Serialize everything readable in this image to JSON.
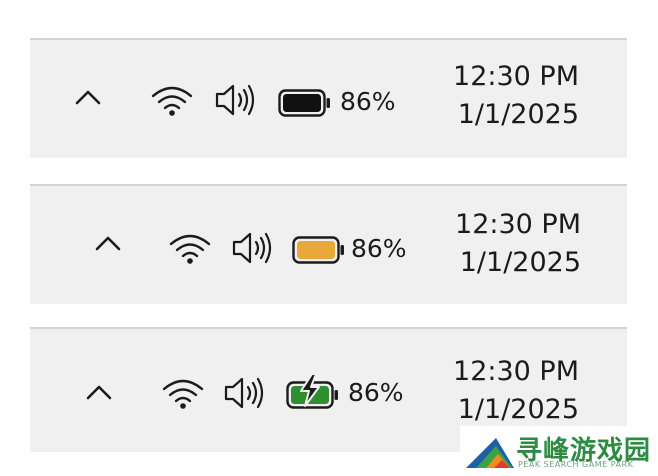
{
  "trays": [
    {
      "variant": "normal",
      "battery_color": "#111111",
      "battery_level": 0.86,
      "chevron_icon": "chevron-up-icon",
      "wifi_icon": "wifi-icon",
      "volume_icon": "speaker-volume-icon",
      "battery_icon": "battery-icon",
      "battery_percent": "86%",
      "time": "12:30 PM",
      "date": "1/1/2025"
    },
    {
      "variant": "battery-saver",
      "battery_color": "#e8a83a",
      "battery_level": 0.86,
      "chevron_icon": "chevron-up-icon",
      "wifi_icon": "wifi-icon",
      "volume_icon": "speaker-volume-icon",
      "battery_icon": "battery-saver-icon",
      "battery_percent": "86%",
      "time": "12:30 PM",
      "date": "1/1/2025"
    },
    {
      "variant": "charging",
      "battery_color": "#2f8f2f",
      "battery_level": 0.86,
      "chevron_icon": "chevron-up-icon",
      "wifi_icon": "wifi-icon",
      "volume_icon": "speaker-volume-icon",
      "battery_icon": "battery-charging-icon",
      "battery_percent": "86%",
      "time": "12:30 PM",
      "date": "1/1/2025"
    }
  ],
  "watermark": {
    "title": "寻峰游戏园",
    "subtitle": "PEAK SEARCH GAME PARK",
    "brand_color": "#2e8c42"
  }
}
